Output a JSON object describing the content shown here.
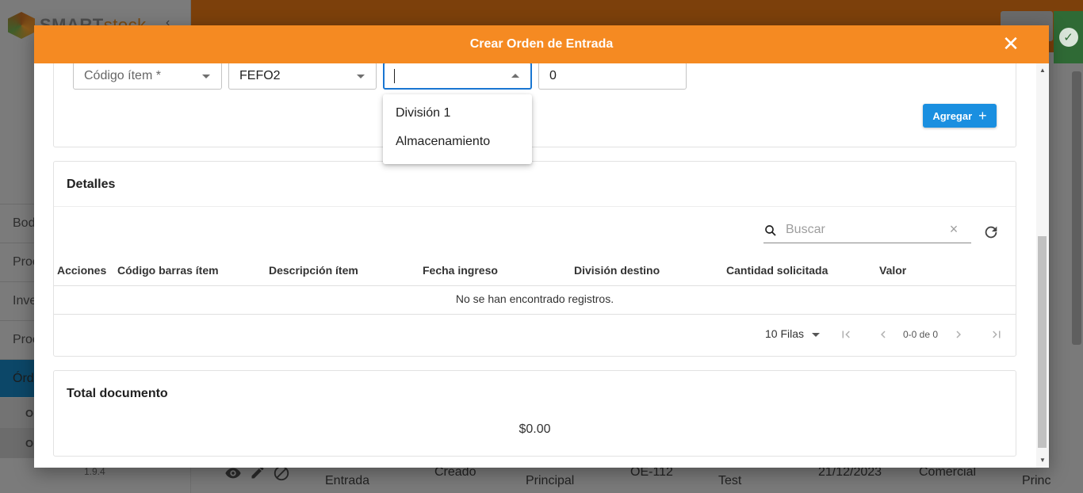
{
  "background": {
    "logo": {
      "main": "SMART",
      "accent": "stock"
    },
    "sidebar_items": [
      {
        "label": "Bod"
      },
      {
        "label": "Proc"
      },
      {
        "label": "Inve"
      },
      {
        "label": "Proc"
      },
      {
        "label": "Órd"
      }
    ],
    "sub_items": [
      {
        "label": "Or"
      },
      {
        "label": "Or"
      }
    ],
    "version": "1.9.4",
    "row": {
      "type": "Entrada",
      "status": "Creado",
      "warehouse": "Principal",
      "code": "OE-112",
      "user": "Test",
      "date": "21/12/2023",
      "division": "Comercial",
      "extra": "Princ"
    }
  },
  "modal": {
    "title": "Crear Orden de Entrada",
    "form": {
      "item_code_placeholder": "Código ítem *",
      "lot_value": "FEFO2",
      "division_value": "",
      "quantity_value": "0",
      "division_options": [
        "División 1",
        "Almacenamiento"
      ],
      "add_button_label": "Agregar"
    },
    "details": {
      "title": "Detalles",
      "search_placeholder": "Buscar",
      "columns": [
        "Acciones",
        "Código barras ítem",
        "Descripción ítem",
        "Fecha ingreso",
        "División destino",
        "Cantidad solicitada",
        "Valor"
      ],
      "empty_message": "No se han encontrado registros.",
      "rows_per_page": "10 Filas",
      "page_info": "0-0 de 0"
    },
    "total": {
      "title": "Total documento",
      "amount": "$0.00"
    }
  },
  "colors": {
    "modal_header": "#f58a22",
    "primary_button": "#1a8fe0",
    "focus": "#1976d2"
  }
}
